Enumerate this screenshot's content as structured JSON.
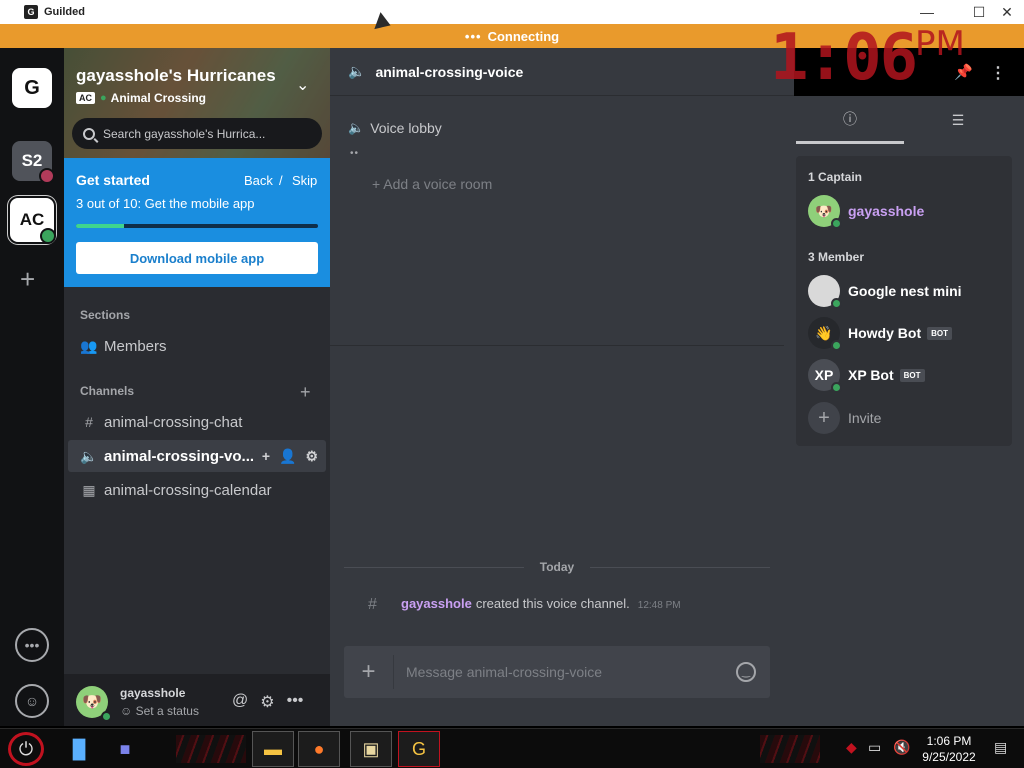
{
  "window": {
    "title": "Guilded",
    "logo_letter": "G",
    "controls": {
      "minimize": "—",
      "maximize": "☐",
      "close": "✕"
    }
  },
  "overlay_clock": {
    "time": "1:06",
    "ampm": "PM"
  },
  "connection": {
    "dots": "•••",
    "text": "Connecting"
  },
  "server_rail": {
    "servers": [
      {
        "label": "G",
        "icon": "guilded-home-icon"
      },
      {
        "label": "S2",
        "icon": "server-icon"
      },
      {
        "label": "AC",
        "icon": "server-icon"
      }
    ],
    "add_icon": "plus-icon",
    "bottom_icons": [
      "chat-bubble-icon",
      "group-icon"
    ]
  },
  "server": {
    "name": "gayasshole's Hurricanes",
    "tag": "AC",
    "game": "Animal Crossing",
    "search_placeholder": "Search gayasshole's Hurrica..."
  },
  "get_started": {
    "title": "Get started",
    "back": "Back",
    "separator": "/",
    "skip": "Skip",
    "step": "3 out of 10: Get the mobile app",
    "progress": 0.2,
    "button": "Download mobile app"
  },
  "sidebar": {
    "sections_label": "Sections",
    "members_label": "Members",
    "channels_label": "Channels",
    "channels": [
      {
        "name": "animal-crossing-chat",
        "icon": "hash-icon",
        "active": false
      },
      {
        "name": "animal-crossing-vo...",
        "icon": "speaker-icon",
        "active": true
      },
      {
        "name": "animal-crossing-calendar",
        "icon": "calendar-icon",
        "active": false
      }
    ]
  },
  "user": {
    "name": "gayasshole",
    "status": "Set a status"
  },
  "channel": {
    "name": "animal-crossing-voice",
    "lobby": "Voice lobby",
    "add_room": "+ Add a voice room",
    "today": "Today",
    "message": {
      "author": "gayasshole",
      "text": "created this voice channel.",
      "time": "12:48 PM"
    },
    "composer_placeholder": "Message animal-crossing-voice"
  },
  "members_panel": {
    "captain_header": "1 Captain",
    "member_header": "3 Member",
    "captain": {
      "name": "gayasshole"
    },
    "members": [
      {
        "name": "Google nest mini",
        "bot": ""
      },
      {
        "name": "Howdy Bot",
        "bot": "BOT"
      },
      {
        "name": "XP Bot",
        "bot": "BOT"
      }
    ],
    "invite": "Invite"
  },
  "taskbar": {
    "time": "1:06 PM",
    "date": "9/25/2022"
  },
  "colors": {
    "accent": "#1a8ee0",
    "connecting": "#e99a2c",
    "online": "#3ba55d",
    "captain_name": "#c9a0f2"
  }
}
